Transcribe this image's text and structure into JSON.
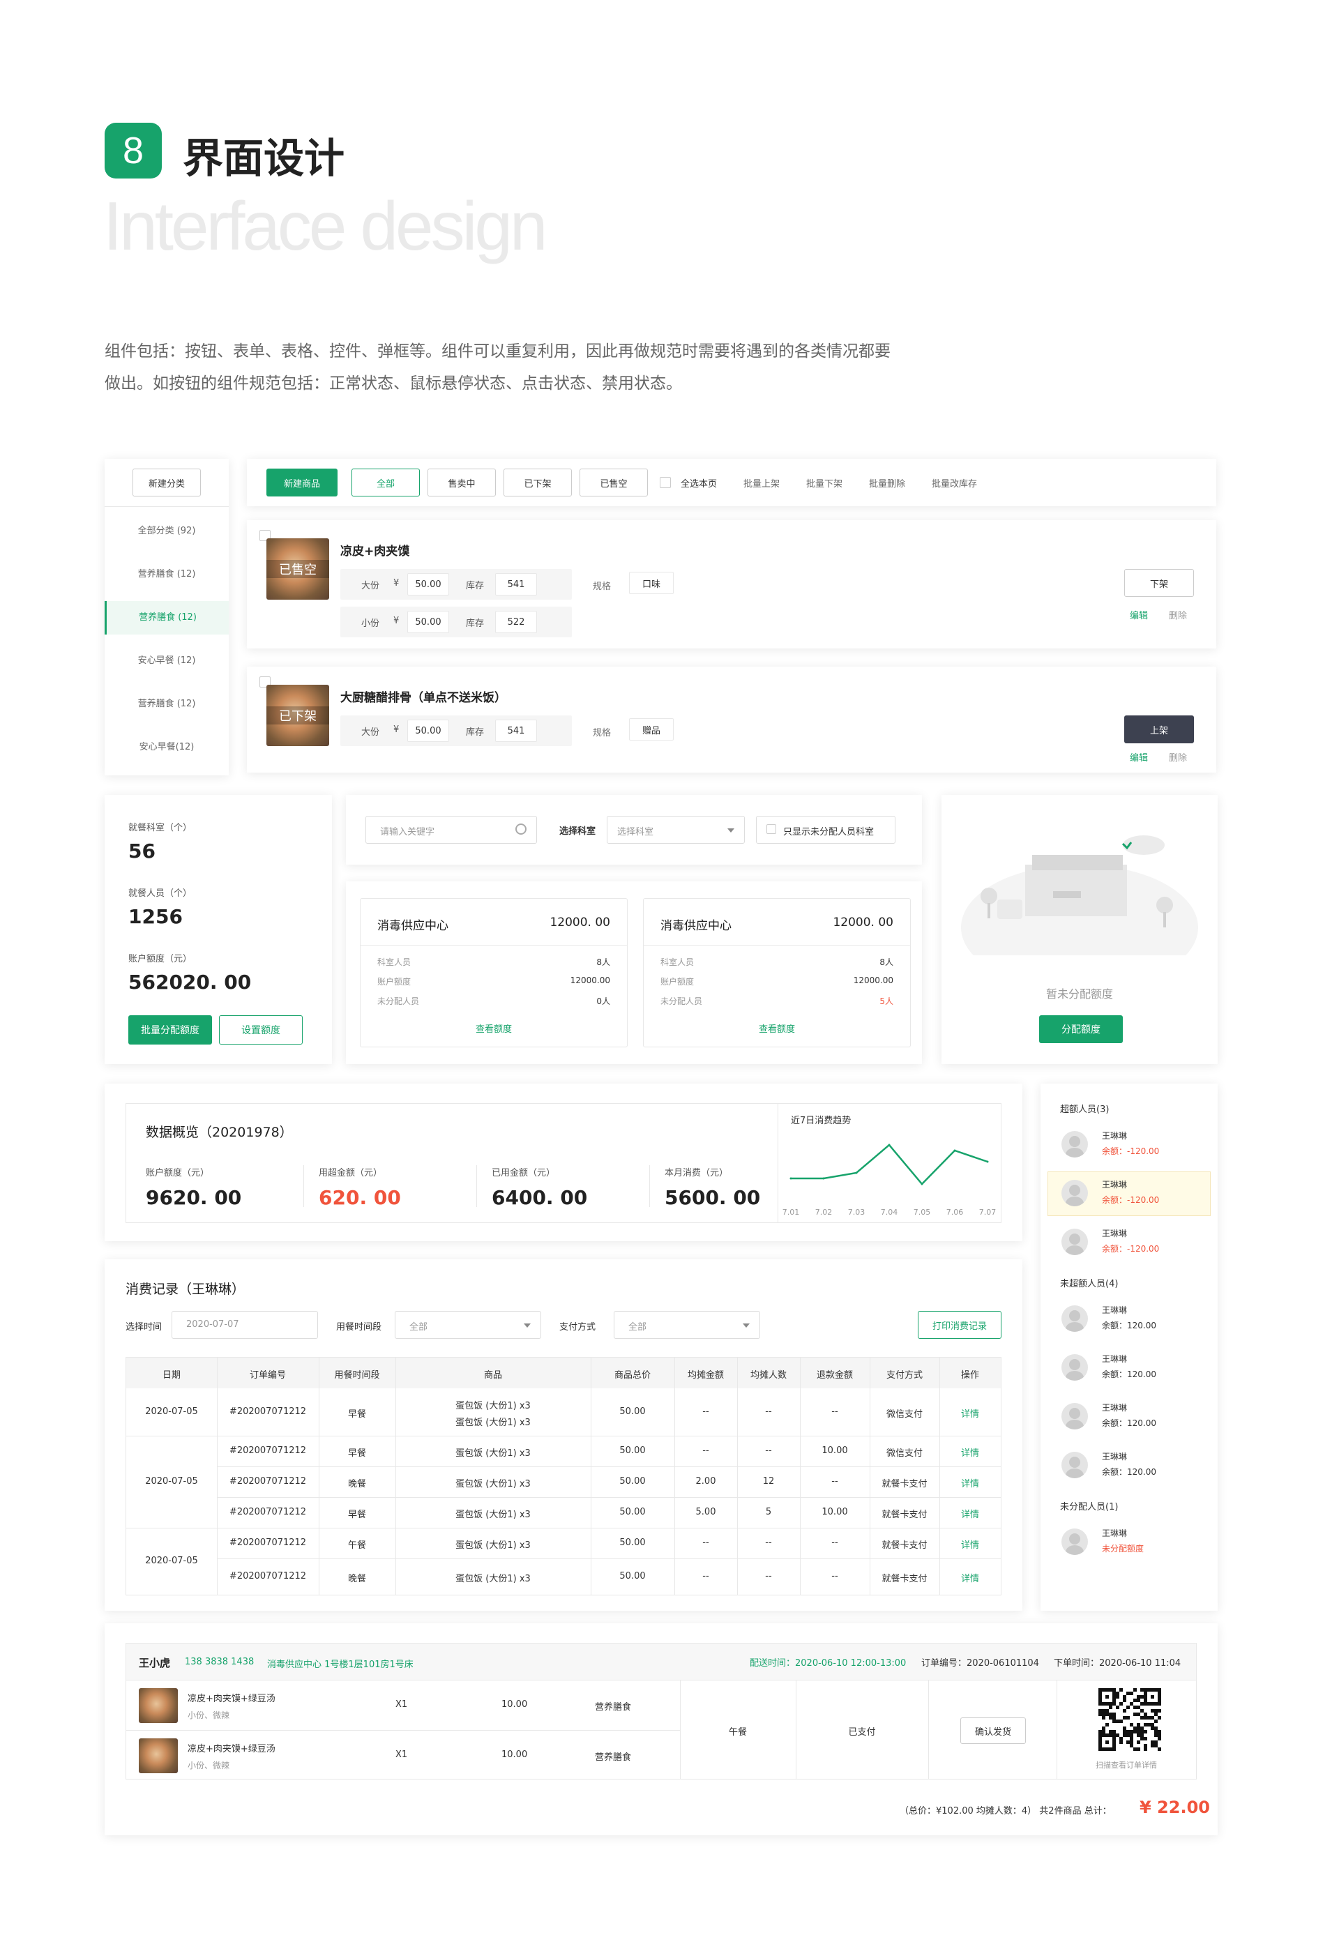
{
  "header": {
    "number": "8",
    "title": "界面设计",
    "subtitle": "Interface design",
    "desc_line1": "组件包括：按钮、表单、表格、控件、弹框等。组件可以重复利用，因此再做规范时需要将遇到的各类情况都要",
    "desc_line2": "做出。如按钮的组件规范包括：正常状态、鼠标悬停状态、点击状态、禁用状态。"
  },
  "sidebar": {
    "new_btn": "新建分类",
    "items": [
      "全部分类 (92)",
      "营养膳食 (12)",
      "营养膳食 (12)",
      "安心早餐 (12)",
      "营养膳食 (12)",
      "安心早餐(12)"
    ]
  },
  "toolbar": {
    "new_btn": "新建商品",
    "tabs": [
      "全部",
      "售卖中",
      "已下架",
      "已售空"
    ],
    "select_page": "全选本页",
    "actions": [
      "批量上架",
      "批量下架",
      "批量删除",
      "批量改库存"
    ]
  },
  "products": [
    {
      "name": "凉皮+肉夹馍",
      "status": "已售空",
      "rows": [
        {
          "size": "大份",
          "currency": "¥",
          "price": "50.00",
          "stock_label": "库存",
          "stock": "541"
        },
        {
          "size": "小份",
          "currency": "¥",
          "price": "50.00",
          "stock_label": "库存",
          "stock": "522"
        }
      ],
      "spec_label": "规格",
      "spec": "口味",
      "action": "下架",
      "edit": "编辑",
      "delete": "删除"
    },
    {
      "name": "大厨糖醋排骨（单点不送米饭）",
      "status": "已下架",
      "rows": [
        {
          "size": "大份",
          "currency": "¥",
          "price": "50.00",
          "stock_label": "库存",
          "stock": "541"
        }
      ],
      "spec_label": "规格",
      "spec": "赠品",
      "action": "上架",
      "edit": "编辑",
      "delete": "删除"
    }
  ],
  "stats": {
    "items": [
      {
        "label": "就餐科室（个）",
        "value": "56"
      },
      {
        "label": "就餐人员（个）",
        "value": "1256"
      },
      {
        "label": "账户额度（元）",
        "value": "562020. 00"
      }
    ],
    "btn_batch": "批量分配额度",
    "btn_set": "设置额度"
  },
  "filter": {
    "search_placeholder": "请输入关键字",
    "dept_label": "选择科室",
    "dept_placeholder": "选择科室",
    "only_unassigned": "只显示未分配人员科室"
  },
  "supply_cards": [
    {
      "title": "消毒供应中心",
      "amount": "12000. 00",
      "rows": [
        [
          "科室人员",
          "8人"
        ],
        [
          "账户额度",
          "12000.00"
        ],
        [
          "未分配人员",
          "0人"
        ]
      ],
      "link": "查看额度",
      "highlight_last": false
    },
    {
      "title": "消毒供应中心",
      "amount": "12000. 00",
      "rows": [
        [
          "科室人员",
          "8人"
        ],
        [
          "账户额度",
          "12000.00"
        ],
        [
          "未分配人员",
          "5人"
        ]
      ],
      "link": "查看额度",
      "highlight_last": true
    }
  ],
  "empty_state": {
    "text": "暂未分配额度",
    "btn": "分配额度"
  },
  "overview": {
    "title": "数据概览（20201978）",
    "items": [
      {
        "label": "账户额度（元）",
        "value": "9620. 00",
        "red": false
      },
      {
        "label": "用超金额（元）",
        "value": "620. 00",
        "red": true
      },
      {
        "label": "已用金额（元）",
        "value": "6400. 00",
        "red": false
      },
      {
        "label": "本月消费（元）",
        "value": "5600. 00",
        "red": false
      }
    ]
  },
  "chart_data": {
    "type": "line",
    "title": "近7日消费趋势",
    "categories": [
      "7.01",
      "7.02",
      "7.03",
      "7.04",
      "7.05",
      "7.06",
      "7.07"
    ],
    "values": [
      4,
      4,
      5,
      10,
      3,
      9,
      7
    ],
    "ylim": [
      0,
      12
    ],
    "color": "#17a36b",
    "grid": false
  },
  "records": {
    "title": "消费记录（王琳琳）",
    "time_label": "选择时间",
    "time_value": "2020-07-07",
    "period_label": "用餐时间段",
    "period_value": "全部",
    "pay_label": "支付方式",
    "pay_value": "全部",
    "print_btn": "打印消费记录",
    "columns": [
      "日期",
      "订单编号",
      "用餐时间段",
      "商品",
      "商品总价",
      "均摊金额",
      "均摊人数",
      "退款金额",
      "支付方式",
      "操作"
    ],
    "rows": [
      {
        "date": "2020-07-05",
        "order": "#202007071212",
        "period": "早餐",
        "goods": [
          "蛋包饭 (大份1) x3",
          "蛋包饭 (大份1) x3"
        ],
        "total": "50.00",
        "share": "--",
        "people": "--",
        "refund": "--",
        "pay": "微信支付",
        "op": "详情"
      },
      {
        "date": "",
        "order": "#202007071212",
        "period": "早餐",
        "goods": [
          "蛋包饭 (大份1) x3"
        ],
        "total": "50.00",
        "share": "--",
        "people": "--",
        "refund": "10.00",
        "pay": "微信支付",
        "op": "详情"
      },
      {
        "date": "2020-07-05",
        "order": "#202007071212",
        "period": "晚餐",
        "goods": [
          "蛋包饭 (大份1) x3"
        ],
        "total": "50.00",
        "share": "2.00",
        "people": "12",
        "refund": "--",
        "pay": "就餐卡支付",
        "op": "详情"
      },
      {
        "date": "",
        "order": "#202007071212",
        "period": "早餐",
        "goods": [
          "蛋包饭 (大份1) x3"
        ],
        "total": "50.00",
        "share": "5.00",
        "people": "5",
        "refund": "10.00",
        "pay": "就餐卡支付",
        "op": "详情"
      },
      {
        "date": "2020-07-05",
        "order": "#202007071212",
        "period": "午餐",
        "goods": [
          "蛋包饭 (大份1) x3"
        ],
        "total": "50.00",
        "share": "--",
        "people": "--",
        "refund": "--",
        "pay": "就餐卡支付",
        "op": "详情"
      },
      {
        "date": "",
        "order": "#202007071212",
        "period": "晚餐",
        "goods": [
          "蛋包饭 (大份1) x3"
        ],
        "total": "50.00",
        "share": "--",
        "people": "--",
        "refund": "--",
        "pay": "就餐卡支付",
        "op": "详情"
      }
    ]
  },
  "people": {
    "over_title": "超额人员(3)",
    "over": [
      {
        "name": "王琳琳",
        "balance": "余额：-120.00"
      },
      {
        "name": "王琳琳",
        "balance": "余额：-120.00"
      },
      {
        "name": "王琳琳",
        "balance": "余额：-120.00"
      }
    ],
    "normal_title": "未超额人员(4)",
    "normal": [
      {
        "name": "王琳琳",
        "balance": "余额：120.00"
      },
      {
        "name": "王琳琳",
        "balance": "余额：120.00"
      },
      {
        "name": "王琳琳",
        "balance": "余额：120.00"
      },
      {
        "name": "王琳琳",
        "balance": "余额：120.00"
      }
    ],
    "unassigned_title": "未分配人员(1)",
    "unassigned": [
      {
        "name": "王琳琳",
        "balance": "未分配额度"
      }
    ]
  },
  "order": {
    "name": "王小虎",
    "phone": "138 3838 1438",
    "address": "消毒供应中心  1号楼1层101房1号床",
    "delivery": "配送时间：2020-06-10 12:00-13:00",
    "order_no": "订单编号：2020-06101104",
    "order_time": "下单时间：2020-06-10  11:04",
    "items": [
      {
        "name": "凉皮+肉夹馍+绿豆汤",
        "spec": "小份、微辣",
        "qty": "X1",
        "price": "10.00",
        "category": "营养膳食"
      },
      {
        "name": "凉皮+肉夹馍+绿豆汤",
        "spec": "小份、微辣",
        "qty": "X1",
        "price": "10.00",
        "category": "营养膳食"
      }
    ],
    "meal": "午餐",
    "paid": "已支付",
    "confirm_btn": "确认发货",
    "qr_text": "扫描查看订单详情",
    "summary": "（总价：¥102.00  均摊人数：4）  共2件商品   总计：",
    "total": "¥ 22.00"
  }
}
